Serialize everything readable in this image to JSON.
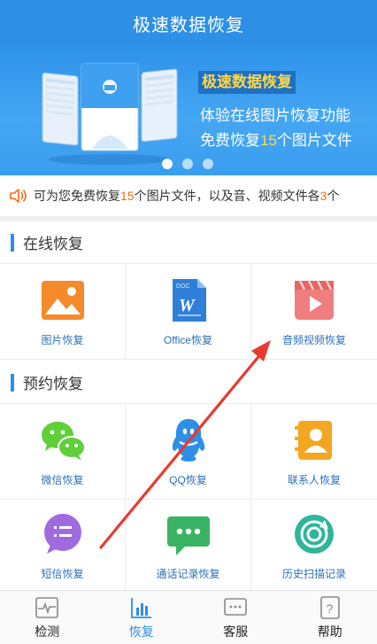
{
  "header": {
    "title": "极速数据恢复"
  },
  "banner": {
    "title": "极速数据恢复",
    "line1": "体验在线图片恢复功能",
    "line2_prefix": "免费恢复",
    "line2_num": "15",
    "line2_suffix": "个图片文件",
    "dots": 3,
    "active_dot": 0
  },
  "notice": {
    "icon": "speaker-icon",
    "prefix": "可为您免费恢复",
    "num1": "15",
    "middle": "个图片文件，以及音、视频文件各",
    "num2": "3",
    "suffix": "个"
  },
  "sections": {
    "online": {
      "title": "在线恢复",
      "items": [
        {
          "label": "图片恢复",
          "icon": "image-icon"
        },
        {
          "label": "Office恢复",
          "icon": "word-doc-icon"
        },
        {
          "label": "音频视频恢复",
          "icon": "video-icon"
        }
      ]
    },
    "appointment": {
      "title": "预约恢复",
      "items": [
        {
          "label": "微信恢复",
          "icon": "wechat-icon"
        },
        {
          "label": "QQ恢复",
          "icon": "qq-icon"
        },
        {
          "label": "联系人恢复",
          "icon": "contacts-icon"
        },
        {
          "label": "短信恢复",
          "icon": "sms-icon"
        },
        {
          "label": "通话记录恢复",
          "icon": "call-log-icon"
        },
        {
          "label": "历史扫描记录",
          "icon": "history-scan-icon"
        }
      ]
    }
  },
  "tabs": [
    {
      "label": "检测",
      "icon": "pulse-icon",
      "active": false
    },
    {
      "label": "恢复",
      "icon": "bar-chart-icon",
      "active": true
    },
    {
      "label": "客服",
      "icon": "chat-icon",
      "active": false
    },
    {
      "label": "帮助",
      "icon": "help-icon",
      "active": false
    }
  ],
  "colors": {
    "primary": "#2d8fe6",
    "highlight": "#f26c10",
    "banner_highlight": "#ffd84a",
    "annotation_arrow": "#e83a2e"
  }
}
